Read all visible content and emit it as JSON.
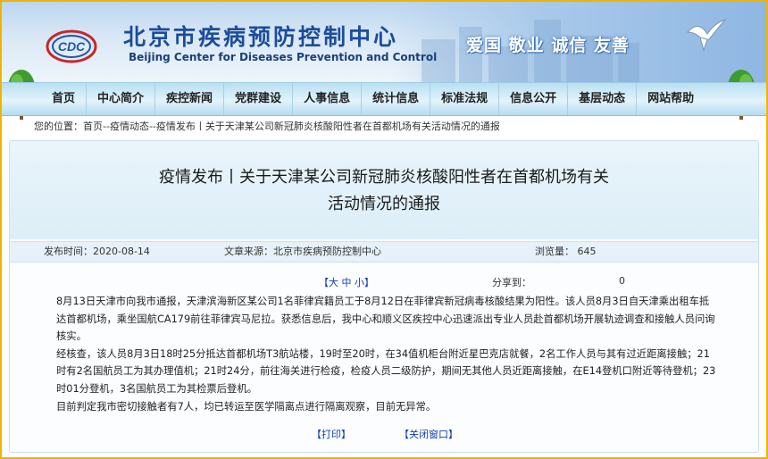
{
  "header": {
    "title_cn": "北京市疾病预防控制中心",
    "title_en": "Beijing Center for Diseases Prevention and Control",
    "logo_text": "CDC",
    "slogan": "爱国 敬业 诚信 友善"
  },
  "nav": {
    "items": [
      "首页",
      "中心简介",
      "疾控新闻",
      "党群建设",
      "人事信息",
      "统计信息",
      "标准法规",
      "信息公开",
      "基层动态",
      "网站帮助"
    ]
  },
  "breadcrumb": "您的位置：首页--疫情动态--疫情发布丨关于天津某公司新冠肺炎核酸阳性者在首都机场有关活动情况的通报",
  "article": {
    "title_line1": "疫情发布丨关于天津某公司新冠肺炎核酸阳性者在首都机场有关",
    "title_line2": "活动情况的通报",
    "publish_time": "发布时间：2020-08-14",
    "source": "文章来源：北京市疾病预防控制中心",
    "views": "浏览量： 645",
    "font_size_prefix": "【",
    "font_size_large": "大",
    "font_size_medium": "中",
    "font_size_small": "小",
    "font_size_suffix": "】",
    "share_label": "分享到：",
    "share_count": "0",
    "paragraphs": [
      "8月13日天津市向我市通报，天津滨海新区某公司1名菲律宾籍员工于8月12日在菲律宾新冠病毒核酸结果为阳性。该人员8月3日自天津乘出租车抵达首都机场，乘坐国航CA179前往菲律宾马尼拉。获悉信息后，我中心和顺义区疾控中心迅速派出专业人员赴首都机场开展轨迹调查和接触人员问询核实。",
      "经核查，该人员8月3日18时25分抵达首都机场T3航站楼，19时至20时，在34值机柜台附近星巴克店就餐，2名工作人员与其有过近距离接触；21时有2名国航员工为其办理值机；21时24分，前往海关进行检疫，检疫人员二级防护，期间无其他人员近距离接触，在E14登机口附近等待登机；23时01分登机，3名国航员工为其检票后登机。",
      "目前判定我市密切接触者有7人，均已转运至医学隔离点进行隔离观察，目前无异常。"
    ],
    "print_label": "【打印】",
    "close_label": "【关闭窗口】"
  },
  "colors": {
    "frame_border": "#f0b400",
    "title_blue": "#1c4c9a",
    "link_blue": "#1040b0",
    "nav_bg": "#d6eef9"
  }
}
